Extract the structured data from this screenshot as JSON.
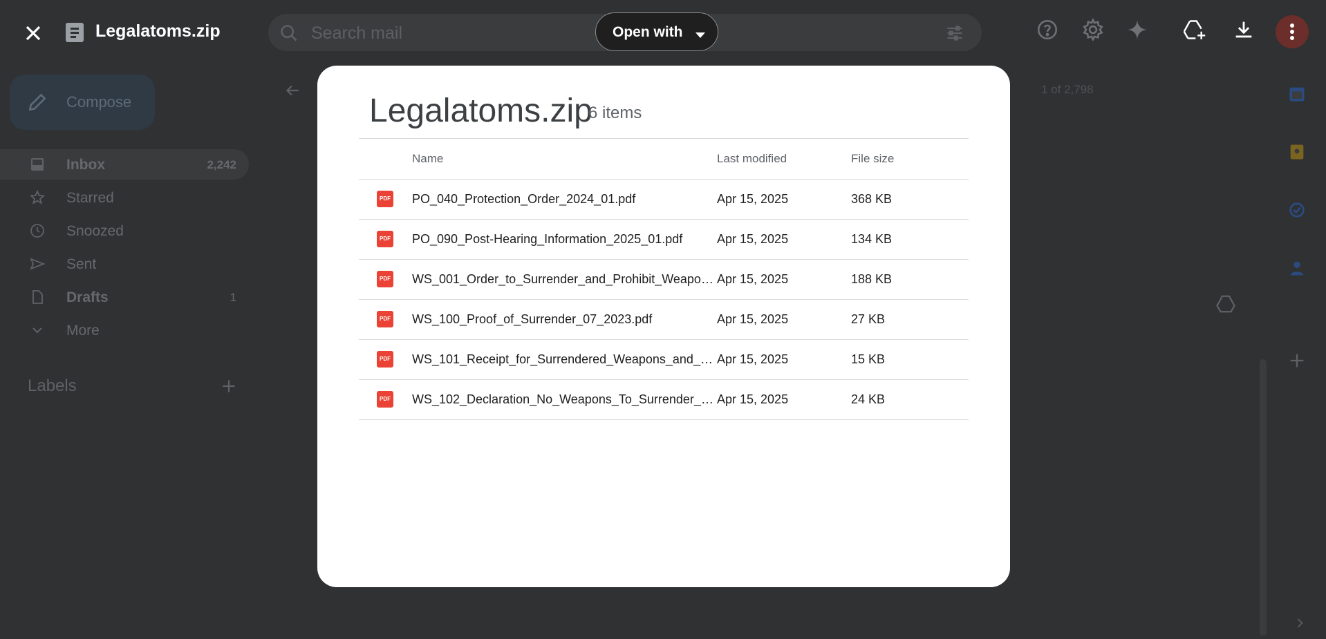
{
  "viewer": {
    "file_title": "Legalatoms.zip",
    "open_with_label": "Open with"
  },
  "background": {
    "search_placeholder": "Search mail",
    "compose_label": "Compose",
    "nav": [
      {
        "label": "Inbox",
        "count": "2,242"
      },
      {
        "label": "Starred",
        "count": ""
      },
      {
        "label": "Snoozed",
        "count": ""
      },
      {
        "label": "Sent",
        "count": ""
      },
      {
        "label": "Drafts",
        "count": "1"
      },
      {
        "label": "More",
        "count": ""
      }
    ],
    "labels_heading": "Labels",
    "pager_text": "1 of 2,798"
  },
  "modal": {
    "title": "Legalatoms.zip",
    "count": "6 items",
    "columns": {
      "name": "Name",
      "modified": "Last modified",
      "size": "File size"
    },
    "files": [
      {
        "name": "PO_040_Protection_Order_2024_01.pdf",
        "modified": "Apr 15, 2025",
        "size": "368 KB"
      },
      {
        "name": "PO_090_Post-Hearing_Information_2025_01.pdf",
        "modified": "Apr 15, 2025",
        "size": "134 KB"
      },
      {
        "name": "WS_001_Order_to_Surrender_and_Prohibit_Weapon…",
        "modified": "Apr 15, 2025",
        "size": "188 KB"
      },
      {
        "name": "WS_100_Proof_of_Surrender_07_2023.pdf",
        "modified": "Apr 15, 2025",
        "size": "27 KB"
      },
      {
        "name": "WS_101_Receipt_for_Surrendered_Weapons_and_C…",
        "modified": "Apr 15, 2025",
        "size": "15 KB"
      },
      {
        "name": "WS_102_Declaration_No_Weapons_To_Surrender_07…",
        "modified": "Apr 15, 2025",
        "size": "24 KB"
      }
    ],
    "file_badge": "PDF"
  }
}
